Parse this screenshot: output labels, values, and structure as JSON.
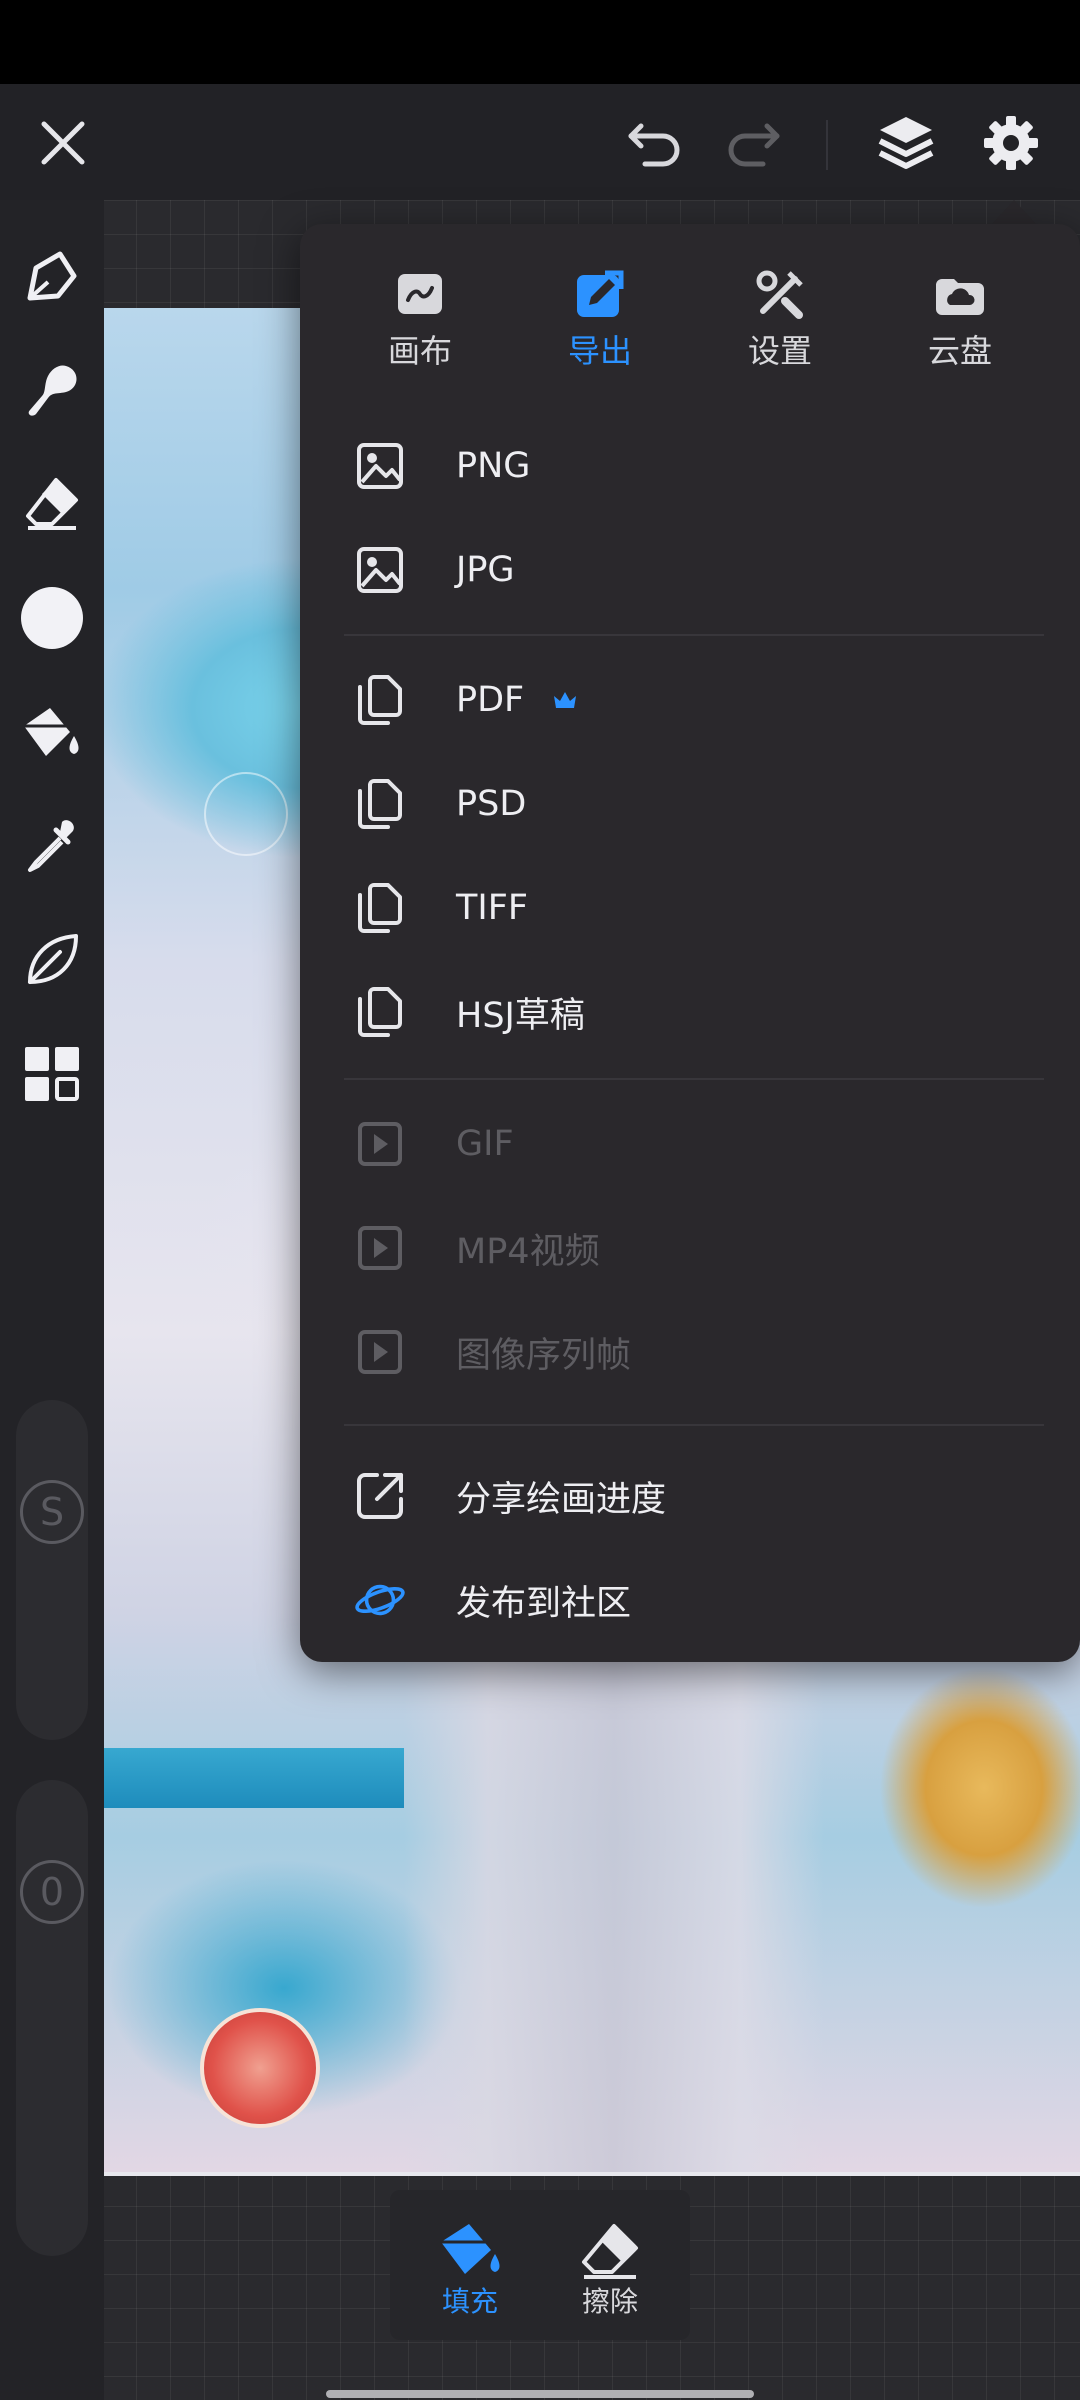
{
  "menu": {
    "tabs": [
      {
        "label": "画布",
        "icon": "canvas-icon",
        "active": false
      },
      {
        "label": "导出",
        "icon": "export-icon",
        "active": true
      },
      {
        "label": "设置",
        "icon": "settings-tools-icon",
        "active": false
      },
      {
        "label": "云盘",
        "icon": "cloud-drive-icon",
        "active": false
      }
    ],
    "image_exports": [
      {
        "label": "PNG",
        "icon": "image-icon"
      },
      {
        "label": "JPG",
        "icon": "image-icon"
      }
    ],
    "document_exports": [
      {
        "label": "PDF",
        "icon": "file-copy-icon",
        "premium": true
      },
      {
        "label": "PSD",
        "icon": "file-copy-icon"
      },
      {
        "label": "TIFF",
        "icon": "file-copy-icon"
      },
      {
        "label": "HSJ草稿",
        "icon": "file-copy-icon"
      }
    ],
    "video_exports": [
      {
        "label": "GIF",
        "icon": "play-icon",
        "disabled": true
      },
      {
        "label": "MP4视频",
        "icon": "play-icon",
        "disabled": true
      },
      {
        "label": "图像序列帧",
        "icon": "play-icon",
        "disabled": true
      }
    ],
    "share_actions": [
      {
        "label": "分享绘画进度",
        "icon": "share-icon"
      },
      {
        "label": "发布到社区",
        "icon": "planet-icon"
      }
    ]
  },
  "toolbar": {
    "slider_size_label": "S",
    "slider_opacity_label": "0"
  },
  "bottom_panel": {
    "fill_label": "填充",
    "erase_label": "擦除"
  },
  "colors": {
    "accent": "#2c92ff",
    "menu_bg": "#2a282c",
    "toolbar_bg": "#222226",
    "text_disabled": "#5e5d62"
  }
}
